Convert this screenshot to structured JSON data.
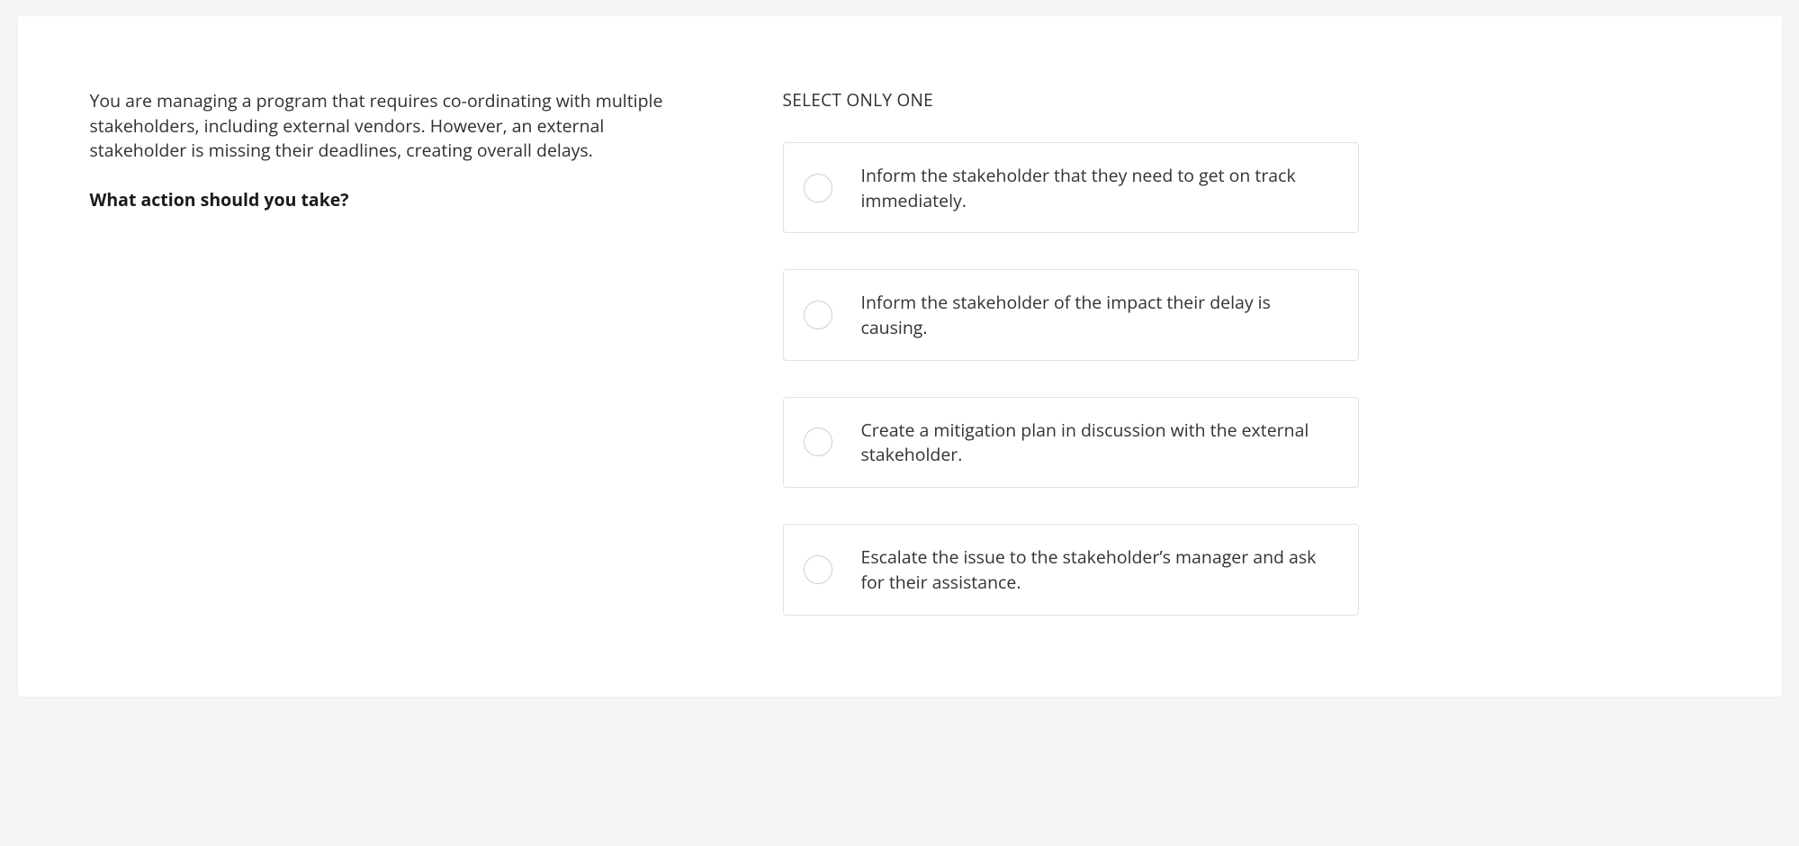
{
  "question": {
    "scenario": "You are managing a program that requires co-ordinating with multiple stakeholders, including external vendors. However, an external stakeholder is missing their deadlines, creating overall delays.",
    "prompt": "What action should you take?"
  },
  "instruction": "SELECT ONLY ONE",
  "options": [
    {
      "label": "Inform the stakeholder that they need to get on track immediately."
    },
    {
      "label": "Inform the stakeholder of the impact their delay is causing."
    },
    {
      "label": "Create a mitigation plan in discussion with the external stakeholder."
    },
    {
      "label": "Escalate the issue to the stakeholder’s manager and ask for their assistance."
    }
  ]
}
